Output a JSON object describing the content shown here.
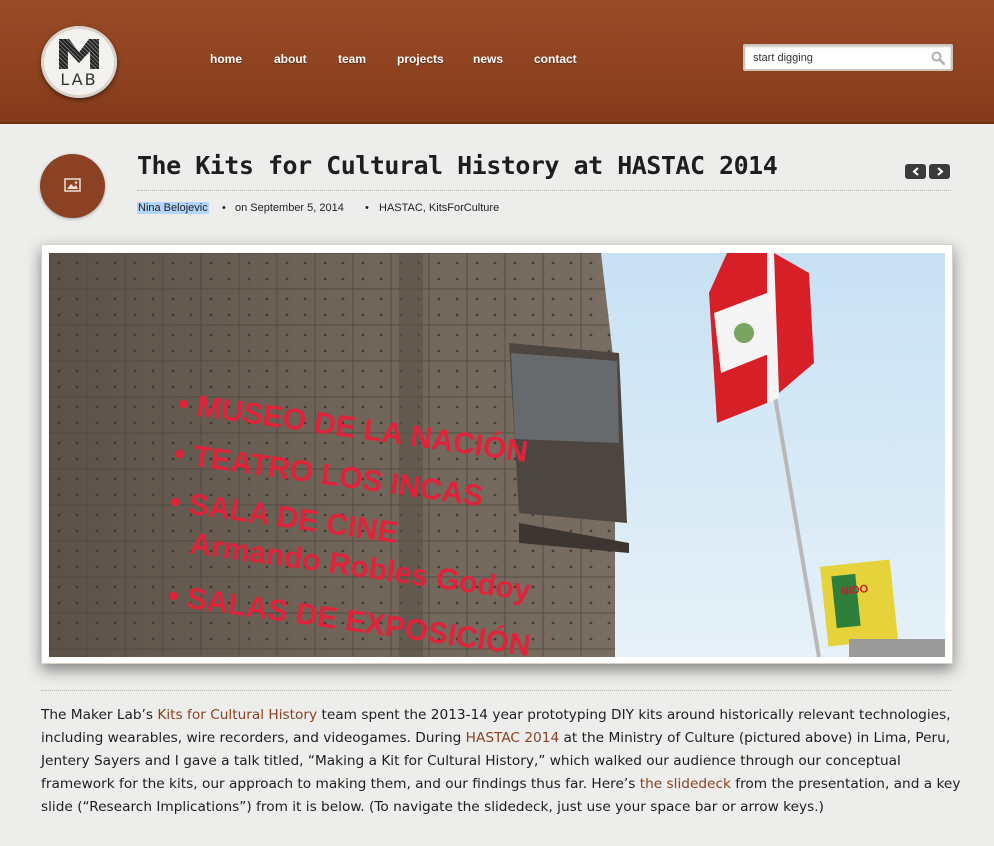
{
  "header": {
    "logo_text": "LAB",
    "nav": [
      {
        "label": "home",
        "name": "nav-home"
      },
      {
        "label": "about",
        "name": "nav-about"
      },
      {
        "label": "team",
        "name": "nav-team"
      },
      {
        "label": "projects",
        "name": "nav-projects"
      },
      {
        "label": "news",
        "name": "nav-news"
      },
      {
        "label": "contact",
        "name": "nav-contact"
      }
    ],
    "search": {
      "value": "start digging",
      "icon": "search-icon"
    }
  },
  "post": {
    "icon": "image-icon",
    "title": "The Kits for Cultural History at HASTAC 2014",
    "prev_icon": "chevron-left-icon",
    "next_icon": "chevron-right-icon",
    "author": "Nina Belojevic",
    "bullet": "•",
    "date": "on September 5, 2014",
    "categories": "HASTAC, KitsForCulture",
    "photo": {
      "sign_lines": [
        "• MUSEO DE LA NACIÓN",
        "• TEATRO LOS INCAS",
        "• SALA DE CINE",
        "Armando Robles Godoy",
        "• SALAS DE EXPOSICIÓN"
      ],
      "billboard_text": "NIDO"
    },
    "body": {
      "p1": "The Maker Lab’s ",
      "link1": "Kits for Cultural History",
      "p2": " team spent the 2013-14 year prototyping DIY kits around historically relevant technologies, including wearables, wire recorders, and videogames. During ",
      "link2": "HASTAC 2014",
      "p3": " at the Ministry of Culture (pictured above) in Lima, Peru, Jentery Sayers and I gave a talk titled, “Making a Kit for Cultural History,” which walked our audience through our conceptual framework for the kits, our approach to making them, and our findings thus far. Here’s ",
      "link3": "the slidedeck",
      "p4": " from the presentation, and a key slide (“Research Implications”) from it is below. (To navigate the slidedeck, just use your space bar or arrow keys.)"
    }
  },
  "colors": {
    "header": "#8e4220",
    "accent": "#8b4224",
    "background": "#ededeb"
  }
}
